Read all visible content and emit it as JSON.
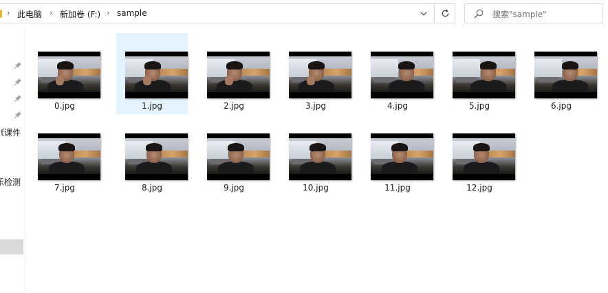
{
  "address_bar": {
    "breadcrumbs": [
      {
        "label": "此电脑"
      },
      {
        "label": "新加卷 (F:)"
      },
      {
        "label": "sample"
      }
    ],
    "dropdown_icon": "chevron-down-icon",
    "refresh_icon": "refresh-icon"
  },
  "search": {
    "placeholder": "搜索\"sample\"",
    "icon": "search-icon"
  },
  "nav_pane": {
    "pinned_count": 4,
    "labels": [
      "…课件",
      "…检测"
    ],
    "labels_visible": [
      "课件",
      "检测"
    ],
    "label_prefix": [
      "ť",
      "乐"
    ]
  },
  "files": [
    {
      "name": "0.jpg",
      "selected": false
    },
    {
      "name": "1.jpg",
      "selected": true
    },
    {
      "name": "2.jpg",
      "selected": false
    },
    {
      "name": "3.jpg",
      "selected": false
    },
    {
      "name": "4.jpg",
      "selected": false
    },
    {
      "name": "5.jpg",
      "selected": false
    },
    {
      "name": "6.jpg",
      "selected": false
    },
    {
      "name": "7.jpg",
      "selected": false
    },
    {
      "name": "8.jpg",
      "selected": false
    },
    {
      "name": "9.jpg",
      "selected": false
    },
    {
      "name": "10.jpg",
      "selected": false
    },
    {
      "name": "11.jpg",
      "selected": false
    },
    {
      "name": "12.jpg",
      "selected": false
    }
  ],
  "colors": {
    "selection": "#e5f3ff",
    "folder": "#e8b839"
  }
}
